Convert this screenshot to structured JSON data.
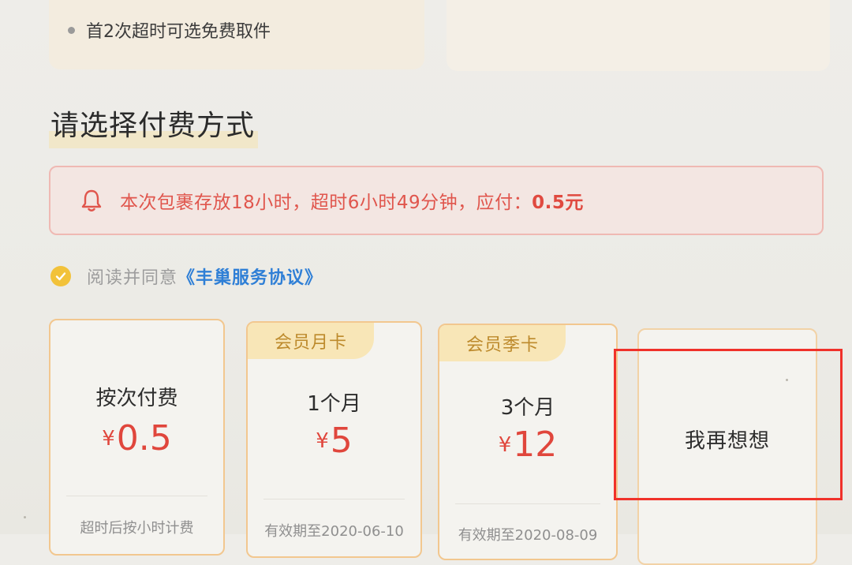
{
  "top_cards": {
    "left_bullet": "首2次超时可选免费取件"
  },
  "section": {
    "title": "请选择付费方式"
  },
  "notice": {
    "icon": "bell-icon",
    "text": "本次包裹存放18小时，超时6小时49分钟，应付：",
    "amount": "0.5元",
    "color": "#e0564d"
  },
  "agreement": {
    "checked": true,
    "prefix": "阅读并同意",
    "link": "《丰巢服务协议》"
  },
  "plans": [
    {
      "tag": "",
      "name": "按次付费",
      "currency": "¥",
      "price": "0.5",
      "foot": "超时后按小时计费"
    },
    {
      "tag": "会员月卡",
      "name": "1个月",
      "currency": "¥",
      "price": "5",
      "foot": "有效期至2020-06-10"
    },
    {
      "tag": "会员季卡",
      "name": "3个月",
      "currency": "¥",
      "price": "12",
      "foot": "有效期至2020-08-09"
    },
    {
      "tag": "",
      "name": "我再想想",
      "currency": "",
      "price": "",
      "foot": ""
    }
  ],
  "colors": {
    "accent_red": "#e0463c",
    "link_blue": "#2f7fd6",
    "check_yellow": "#f2c23a",
    "card_border": "#f2c78f",
    "highlight": "#f0312a"
  }
}
